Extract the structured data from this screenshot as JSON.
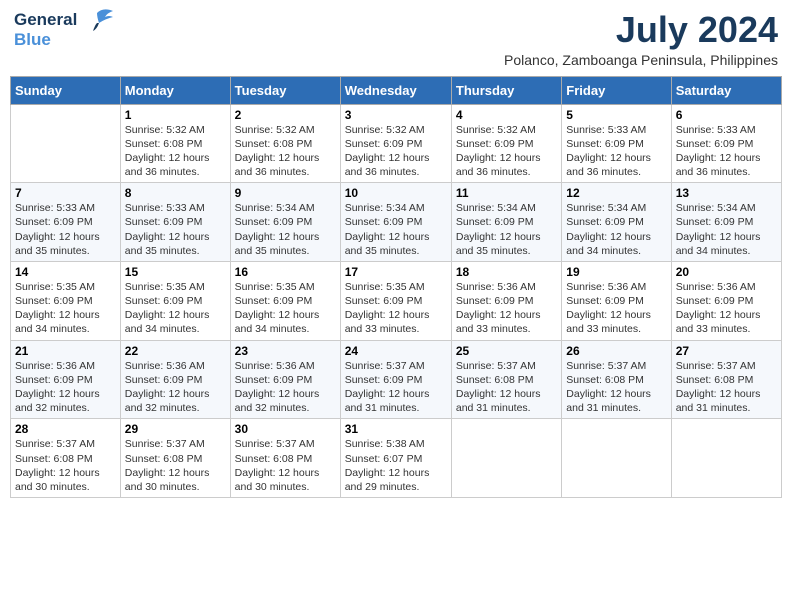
{
  "header": {
    "logo_line1": "General",
    "logo_line2": "Blue",
    "month": "July 2024",
    "location": "Polanco, Zamboanga Peninsula, Philippines"
  },
  "days_of_week": [
    "Sunday",
    "Monday",
    "Tuesday",
    "Wednesday",
    "Thursday",
    "Friday",
    "Saturday"
  ],
  "weeks": [
    [
      {
        "num": "",
        "info": ""
      },
      {
        "num": "1",
        "info": "Sunrise: 5:32 AM\nSunset: 6:08 PM\nDaylight: 12 hours\nand 36 minutes."
      },
      {
        "num": "2",
        "info": "Sunrise: 5:32 AM\nSunset: 6:08 PM\nDaylight: 12 hours\nand 36 minutes."
      },
      {
        "num": "3",
        "info": "Sunrise: 5:32 AM\nSunset: 6:09 PM\nDaylight: 12 hours\nand 36 minutes."
      },
      {
        "num": "4",
        "info": "Sunrise: 5:32 AM\nSunset: 6:09 PM\nDaylight: 12 hours\nand 36 minutes."
      },
      {
        "num": "5",
        "info": "Sunrise: 5:33 AM\nSunset: 6:09 PM\nDaylight: 12 hours\nand 36 minutes."
      },
      {
        "num": "6",
        "info": "Sunrise: 5:33 AM\nSunset: 6:09 PM\nDaylight: 12 hours\nand 36 minutes."
      }
    ],
    [
      {
        "num": "7",
        "info": "Sunrise: 5:33 AM\nSunset: 6:09 PM\nDaylight: 12 hours\nand 35 minutes."
      },
      {
        "num": "8",
        "info": "Sunrise: 5:33 AM\nSunset: 6:09 PM\nDaylight: 12 hours\nand 35 minutes."
      },
      {
        "num": "9",
        "info": "Sunrise: 5:34 AM\nSunset: 6:09 PM\nDaylight: 12 hours\nand 35 minutes."
      },
      {
        "num": "10",
        "info": "Sunrise: 5:34 AM\nSunset: 6:09 PM\nDaylight: 12 hours\nand 35 minutes."
      },
      {
        "num": "11",
        "info": "Sunrise: 5:34 AM\nSunset: 6:09 PM\nDaylight: 12 hours\nand 35 minutes."
      },
      {
        "num": "12",
        "info": "Sunrise: 5:34 AM\nSunset: 6:09 PM\nDaylight: 12 hours\nand 34 minutes."
      },
      {
        "num": "13",
        "info": "Sunrise: 5:34 AM\nSunset: 6:09 PM\nDaylight: 12 hours\nand 34 minutes."
      }
    ],
    [
      {
        "num": "14",
        "info": "Sunrise: 5:35 AM\nSunset: 6:09 PM\nDaylight: 12 hours\nand 34 minutes."
      },
      {
        "num": "15",
        "info": "Sunrise: 5:35 AM\nSunset: 6:09 PM\nDaylight: 12 hours\nand 34 minutes."
      },
      {
        "num": "16",
        "info": "Sunrise: 5:35 AM\nSunset: 6:09 PM\nDaylight: 12 hours\nand 34 minutes."
      },
      {
        "num": "17",
        "info": "Sunrise: 5:35 AM\nSunset: 6:09 PM\nDaylight: 12 hours\nand 33 minutes."
      },
      {
        "num": "18",
        "info": "Sunrise: 5:36 AM\nSunset: 6:09 PM\nDaylight: 12 hours\nand 33 minutes."
      },
      {
        "num": "19",
        "info": "Sunrise: 5:36 AM\nSunset: 6:09 PM\nDaylight: 12 hours\nand 33 minutes."
      },
      {
        "num": "20",
        "info": "Sunrise: 5:36 AM\nSunset: 6:09 PM\nDaylight: 12 hours\nand 33 minutes."
      }
    ],
    [
      {
        "num": "21",
        "info": "Sunrise: 5:36 AM\nSunset: 6:09 PM\nDaylight: 12 hours\nand 32 minutes."
      },
      {
        "num": "22",
        "info": "Sunrise: 5:36 AM\nSunset: 6:09 PM\nDaylight: 12 hours\nand 32 minutes."
      },
      {
        "num": "23",
        "info": "Sunrise: 5:36 AM\nSunset: 6:09 PM\nDaylight: 12 hours\nand 32 minutes."
      },
      {
        "num": "24",
        "info": "Sunrise: 5:37 AM\nSunset: 6:09 PM\nDaylight: 12 hours\nand 31 minutes."
      },
      {
        "num": "25",
        "info": "Sunrise: 5:37 AM\nSunset: 6:08 PM\nDaylight: 12 hours\nand 31 minutes."
      },
      {
        "num": "26",
        "info": "Sunrise: 5:37 AM\nSunset: 6:08 PM\nDaylight: 12 hours\nand 31 minutes."
      },
      {
        "num": "27",
        "info": "Sunrise: 5:37 AM\nSunset: 6:08 PM\nDaylight: 12 hours\nand 31 minutes."
      }
    ],
    [
      {
        "num": "28",
        "info": "Sunrise: 5:37 AM\nSunset: 6:08 PM\nDaylight: 12 hours\nand 30 minutes."
      },
      {
        "num": "29",
        "info": "Sunrise: 5:37 AM\nSunset: 6:08 PM\nDaylight: 12 hours\nand 30 minutes."
      },
      {
        "num": "30",
        "info": "Sunrise: 5:37 AM\nSunset: 6:08 PM\nDaylight: 12 hours\nand 30 minutes."
      },
      {
        "num": "31",
        "info": "Sunrise: 5:38 AM\nSunset: 6:07 PM\nDaylight: 12 hours\nand 29 minutes."
      },
      {
        "num": "",
        "info": ""
      },
      {
        "num": "",
        "info": ""
      },
      {
        "num": "",
        "info": ""
      }
    ]
  ]
}
